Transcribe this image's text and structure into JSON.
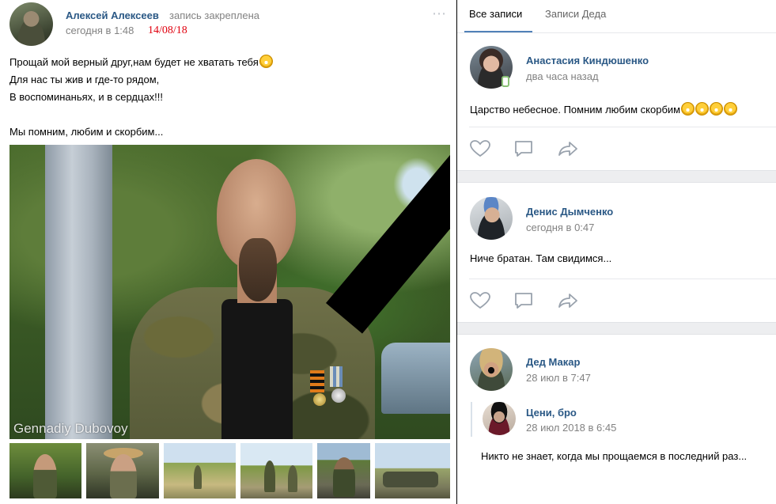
{
  "post": {
    "author": "Алексей Алексеев",
    "pinned_label": "запись закреплена",
    "time": "сегодня в 1:48",
    "date_stamp": "14/08/18",
    "more_icon": "⋯",
    "text_lines": [
      "Прощай мой верный друг,нам будет не хватать тебя",
      "Для нас ты жив и где-то рядом,",
      "В воспоминаньях, и в сердцах!!!",
      "",
      "Мы помним, любим и скорбим..."
    ],
    "photo_watermark": "Gennadiy Dubovoy",
    "thumbnail_count": 6
  },
  "tabs": {
    "all": "Все записи",
    "ded": "Записи Деда",
    "active": "all"
  },
  "comments": [
    {
      "name": "Анастасия Киндюшенко",
      "time": "два часа назад",
      "text": "Царство небесное. Помним любим скорбим",
      "emoji_count": 4,
      "online_mobile": true
    },
    {
      "name": "Денис Дымченко",
      "time": "сегодня в 0:47",
      "text": "Ниче братан. Там свидимся..."
    },
    {
      "name": "Дед Макар",
      "time": "28 июл в 7:47",
      "repost": {
        "name": "Цени, бро",
        "time": "28 июл 2018 в 6:45"
      },
      "text": "Никто не знает, когда мы прощаемся в последний раз..."
    }
  ],
  "icons": {
    "like": "heart-icon",
    "comment": "comment-icon",
    "share": "share-icon"
  },
  "colors": {
    "link": "#2a5885",
    "meta": "#828282",
    "accent": "#5181b8",
    "date_stamp": "#e0000e"
  }
}
